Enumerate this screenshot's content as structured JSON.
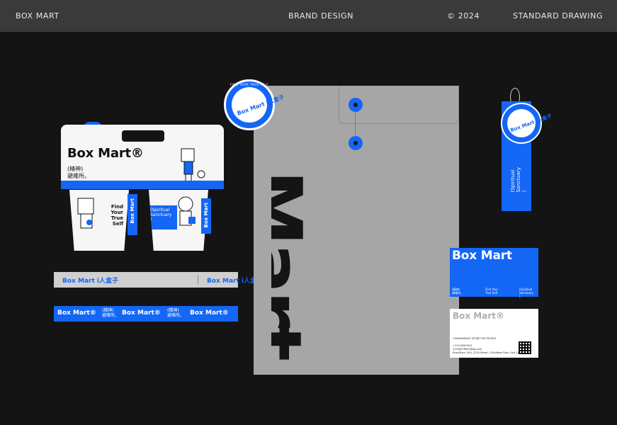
{
  "header": {
    "brand": "BOX MART",
    "section": "BRAND  DESIGN",
    "year": "© 2024",
    "drawing": "STANDARD  DRAWING"
  },
  "carrier": {
    "logo": "Box Mart®",
    "tagline_cn": "(精神)\n避难所。",
    "cup_left_text": "Find\nYour\nTrue\nSelf",
    "cup_left_band": "Box Mart",
    "cup_right_text": "(Spiritual\nSanctuary\n)",
    "cup_right_band": "Box Mart"
  },
  "tape_gray": {
    "segment_1": "Box Mart i人盒子",
    "segment_2": "Box Mart i人盒子"
  },
  "tape_blue": {
    "segment_1": "Box Mart®",
    "cn_1": "(精神)\n避难所。",
    "segment_2": "Box Mart®",
    "cn_2": "(精神)\n避难所。",
    "segment_3": "Box Mart®"
  },
  "envelope": {
    "big_text": "Mart"
  },
  "sticker": {
    "ring_text": "FIND YOUR TRUE SELF",
    "logo": "Box Mart i人盒子"
  },
  "hang_tag": {
    "logo": "Box Mart i人盒子",
    "vertical_text": "(Spiritual\nSanctuary\n)"
  },
  "card_blue": {
    "logo": "Box Mart",
    "col_1": "(精神)\n避难所。",
    "col_2": "Find Your\nTrue Self",
    "col_3": "(Spiritual\nSanctuary\n)"
  },
  "card_white": {
    "logo": "Box Mart®",
    "subtitle": "CONVENIENCE STORE FOR PEOPLE",
    "phone": "+71234567812",
    "email": "12345678901@qq.com",
    "address": "ShenZhen, 000, 1234 Street, 1 Building Floor, Unit 101"
  },
  "colors": {
    "accent": "#1466f5",
    "background": "#141414",
    "header_bg": "#3a3a3a",
    "envelope": "#a6a6a6"
  }
}
